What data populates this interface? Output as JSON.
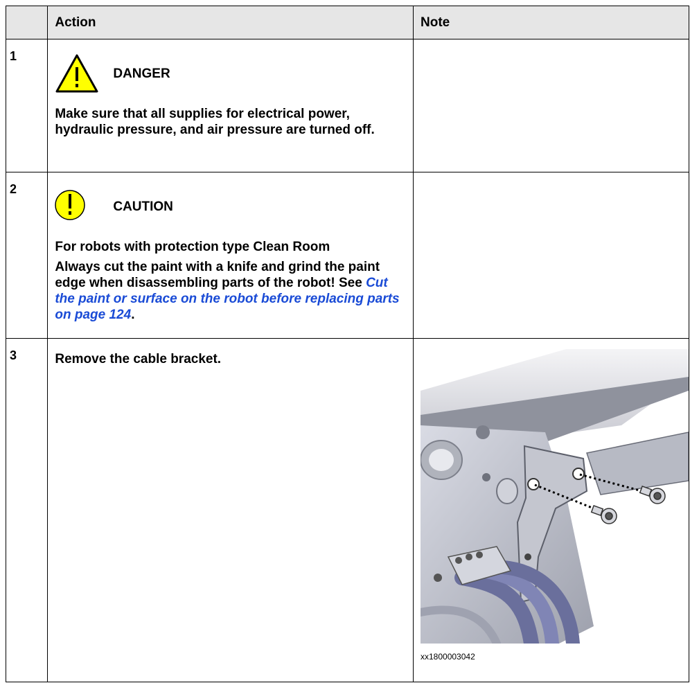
{
  "table": {
    "headers": [
      "",
      "Action",
      "Note"
    ],
    "rows": [
      {
        "step": "1",
        "sign": {
          "icon": "danger-triangle-icon",
          "label": "DANGER",
          "color": "#ffff00"
        },
        "text": "Make sure that all supplies for electrical power, hydraulic pressure, and air pressure are turned off."
      },
      {
        "step": "2",
        "sign": {
          "icon": "caution-circle-icon",
          "label": "CAUTION",
          "color": "#ffff00"
        },
        "subheading": "For robots with protection type Clean Room",
        "text": "Always cut the paint with a knife and grind the paint edge when disassembling parts of the robot!",
        "see_prefix": "See ",
        "link_text": "Cut the paint or surface on the robot before replacing parts on page 124",
        "see_suffix": "."
      },
      {
        "step": "3",
        "text": "Remove the cable bracket.",
        "figure_caption": "xx1800003042"
      }
    ]
  }
}
